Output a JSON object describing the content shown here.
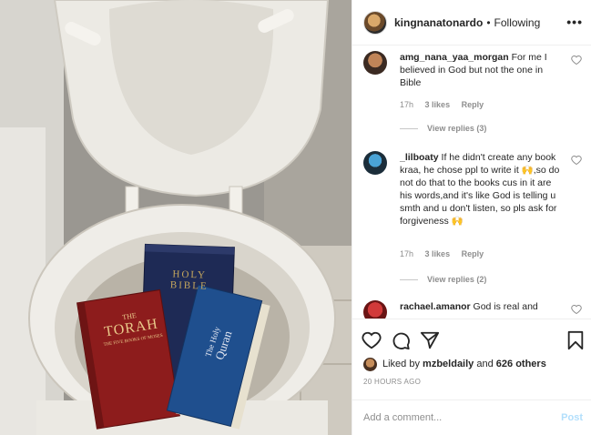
{
  "post": {
    "username": "kingnanatonardo",
    "separator": "•",
    "follow_status": "Following",
    "more_label": "•••"
  },
  "photo": {
    "book1_title": "TORAH",
    "book1_prefix": "THE",
    "book1_sub": "THE FIVE BOOKS OF MOSES",
    "book2_title_line1": "HOLY",
    "book2_title_line2": "BIBLE",
    "book3_title_line1": "The Holy",
    "book3_title_line2": "Quran"
  },
  "comments": [
    {
      "username": "amg_nana_yaa_morgan",
      "text": "For me I believed in God but not the one in Bible",
      "time": "17h",
      "likes": "3 likes",
      "reply": "Reply",
      "view_replies": "View replies (3)"
    },
    {
      "username": "_lilboaty",
      "text": "If he didn't create any book kraa, he chose ppl to write it 🙌,so do not do that to the books cus in it are his words,and it's like God is telling u smth and u don't listen, so pls ask for forgiveness 🙌",
      "time": "17h",
      "likes": "3 likes",
      "reply": "Reply",
      "view_replies": "View replies (2)"
    },
    {
      "username": "rachael.amanor",
      "text": "God is real and"
    }
  ],
  "actions": {
    "liked_by_prefix": "Liked by",
    "liked_by_user": "mzbeldaily",
    "liked_by_and": "and",
    "liked_by_others": "626 others",
    "time_ago": "20 HOURS AGO"
  },
  "add_comment": {
    "placeholder": "Add a comment...",
    "post_label": "Post"
  },
  "icons": [
    "heart-icon",
    "comment-icon",
    "share-icon",
    "bookmark-icon",
    "more-icon"
  ],
  "colors": {
    "link_disabled": "#b2dffc",
    "muted": "#8e8e8e",
    "text": "#262626"
  }
}
